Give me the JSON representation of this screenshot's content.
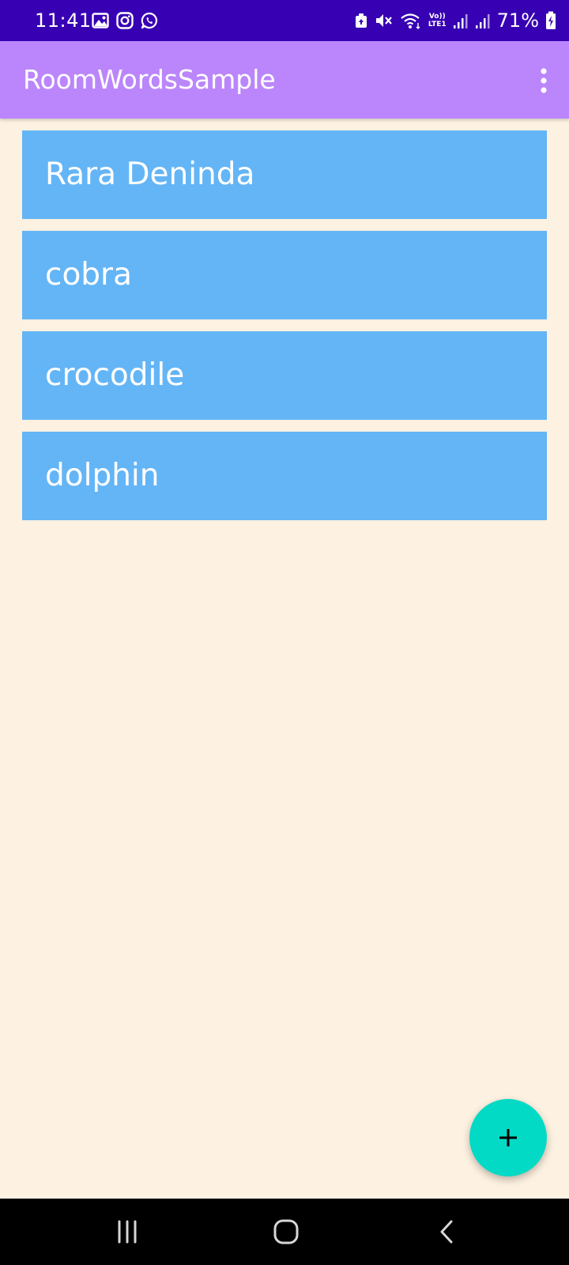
{
  "status_bar": {
    "time": "11:41",
    "left_icons": [
      "gallery-icon",
      "instagram-icon",
      "whatsapp-icon"
    ],
    "right_icons": [
      "data-saver-icon",
      "mute-icon",
      "wifi-icon",
      "volte-icon",
      "signal-icon",
      "signal-icon",
      "battery-charging-icon"
    ],
    "volte_label_top": "Vo))",
    "volte_label_bottom": "LTE1",
    "battery": "71%"
  },
  "app_bar": {
    "title": "RoomWordsSample",
    "menu_icon": "more-vert-icon"
  },
  "words": [
    {
      "text": "Rara Deninda"
    },
    {
      "text": "cobra"
    },
    {
      "text": "crocodile"
    },
    {
      "text": "dolphin"
    }
  ],
  "fab": {
    "icon": "plus-icon"
  },
  "navigation": {
    "buttons": [
      "recents-icon",
      "home-icon",
      "back-icon"
    ]
  },
  "colors": {
    "status_bar": "#3700B3",
    "app_bar": "#BB86FC",
    "background": "#FDF1E1",
    "list_item": "#64B5F6",
    "fab": "#03DAC5",
    "nav_bar": "#000000"
  }
}
